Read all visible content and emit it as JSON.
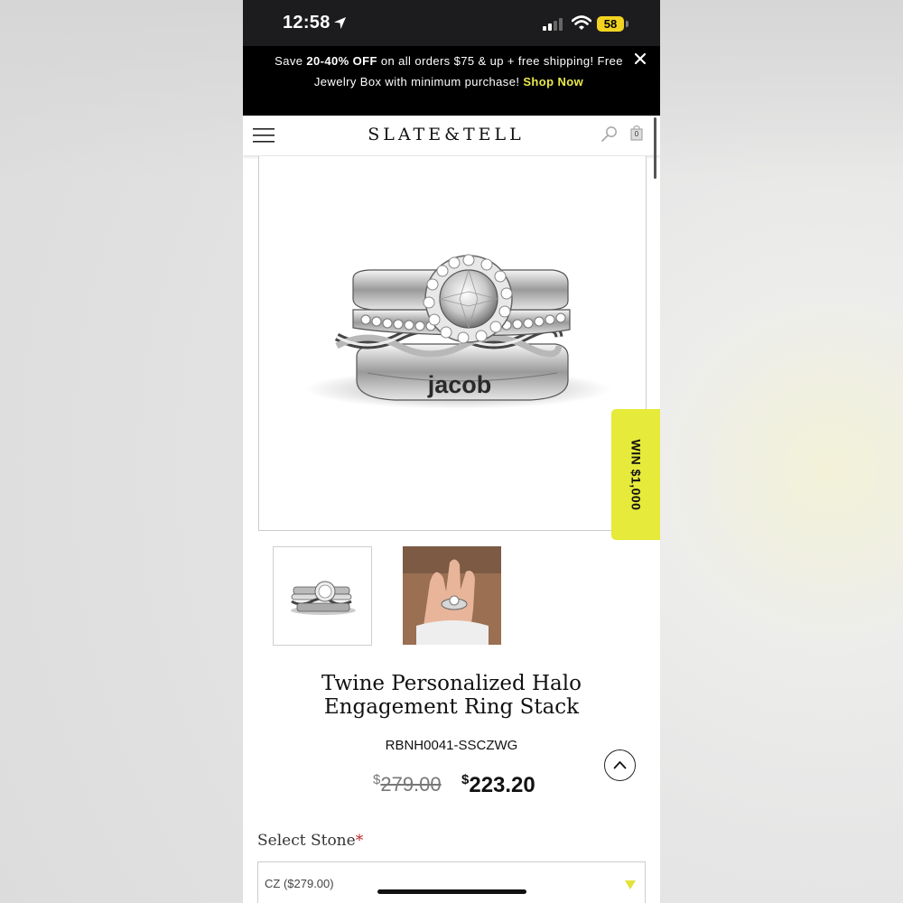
{
  "status_bar": {
    "time": "12:58",
    "battery": "58"
  },
  "promo": {
    "text_before": "Save ",
    "discount": "20-40% OFF",
    "text_after": " on all orders $75 & up + free shipping! Free Jewelry Box with minimum purchase! ",
    "shop_link": "Shop Now"
  },
  "header": {
    "brand": "SLATE&TELL",
    "cart_count": "0"
  },
  "main_image": {
    "engraving": "jacob"
  },
  "win_tab": {
    "label": "WIN $1,000"
  },
  "product": {
    "title": "Twine Personalized Halo Engagement Ring Stack",
    "sku": "RBNH0041-SSCZWG",
    "currency_symbol": "$",
    "price_original": "279.00",
    "price_sale": "223.20"
  },
  "options": {
    "stone_label": "Select Stone",
    "required_mark": "*",
    "stone_value": "CZ ($279.00)"
  },
  "icons": [
    "location-arrow-icon",
    "signal-icon",
    "wifi-icon",
    "close-icon",
    "menu-icon",
    "search-icon",
    "cart-icon",
    "chevron-up-icon",
    "dropdown-triangle-icon"
  ],
  "colors": {
    "accent_yellow": "#e6ea3a",
    "promo_bg": "#000000",
    "shop_link": "#e9e84c",
    "required": "#c0262b"
  }
}
